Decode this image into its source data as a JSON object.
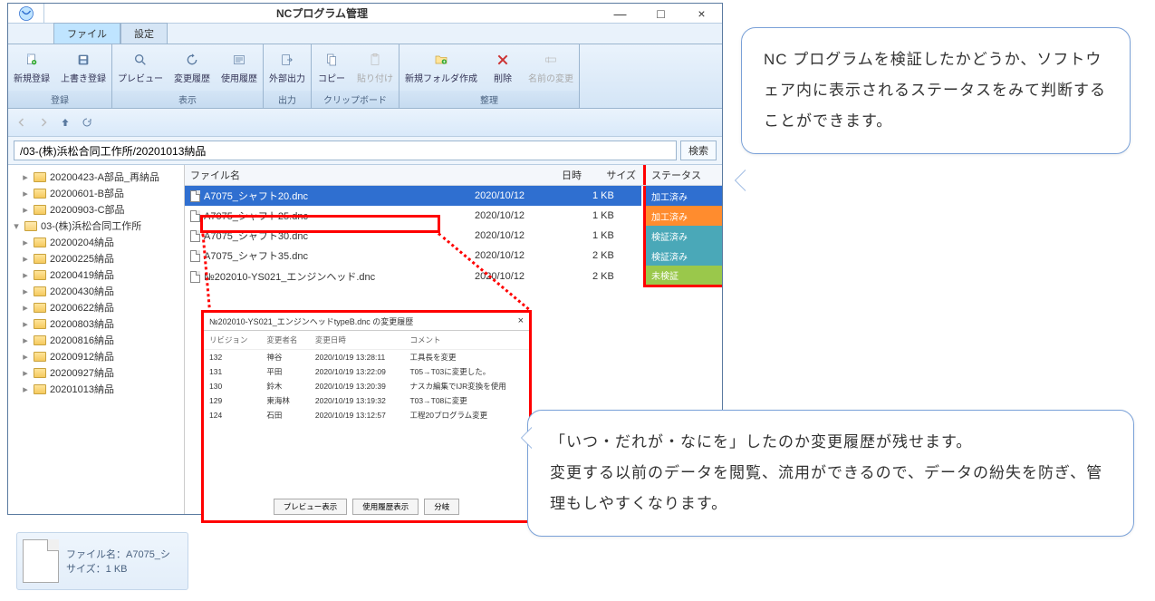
{
  "window": {
    "title": "NCプログラム管理"
  },
  "tabs": {
    "file": "ファイル",
    "settings": "設定"
  },
  "ribbon": {
    "groups": {
      "register": {
        "label": "登録",
        "btns": {
          "new": "新規登録",
          "overwrite": "上書き登録"
        }
      },
      "display": {
        "label": "表示",
        "btns": {
          "preview": "プレビュー",
          "changelog": "変更履歴",
          "usagelog": "使用履歴"
        }
      },
      "output": {
        "label": "出力",
        "btns": {
          "external": "外部出力"
        }
      },
      "clipboard": {
        "label": "クリップボード",
        "btns": {
          "copy": "コピー",
          "paste": "貼り付け"
        }
      },
      "organize": {
        "label": "整理",
        "btns": {
          "newfolder": "新規フォルダ作成",
          "delete": "削除",
          "rename": "名前の変更"
        }
      }
    }
  },
  "path": "/03-(株)浜松合同工作所/20201013納品",
  "search": {
    "label": "検索"
  },
  "tree": {
    "items": [
      {
        "name": "20200423-A部品_再納品",
        "depth": 1
      },
      {
        "name": "20200601-B部品",
        "depth": 1
      },
      {
        "name": "20200903-C部品",
        "depth": 1
      },
      {
        "name": "03-(株)浜松合同工作所",
        "depth": 0,
        "open": true
      },
      {
        "name": "20200204納品",
        "depth": 1
      },
      {
        "name": "20200225納品",
        "depth": 1
      },
      {
        "name": "20200419納品",
        "depth": 1
      },
      {
        "name": "20200430納品",
        "depth": 1
      },
      {
        "name": "20200622納品",
        "depth": 1
      },
      {
        "name": "20200803納品",
        "depth": 1
      },
      {
        "name": "20200816納品",
        "depth": 1
      },
      {
        "name": "20200912納品",
        "depth": 1
      },
      {
        "name": "20200927納品",
        "depth": 1
      },
      {
        "name": "20201013納品",
        "depth": 1
      }
    ]
  },
  "list": {
    "headers": {
      "name": "ファイル名",
      "date": "日時",
      "size": "サイズ",
      "status": "ステータス"
    },
    "rows": [
      {
        "name": "A7075_シャフト20.dnc",
        "date": "2020/10/12",
        "size": "1 KB",
        "status": "加工済み",
        "selected": true
      },
      {
        "name": "A7075_シャフト25.dnc",
        "date": "2020/10/12",
        "size": "1 KB",
        "status": "加工済み"
      },
      {
        "name": "A7075_シャフト30.dnc",
        "date": "2020/10/12",
        "size": "1 KB",
        "status": "検証済み"
      },
      {
        "name": "A7075_シャフト35.dnc",
        "date": "2020/10/12",
        "size": "2 KB",
        "status": "検証済み"
      },
      {
        "name": "№202010-YS021_エンジンヘッド.dnc",
        "date": "2020/10/12",
        "size": "2 KB",
        "status": "未検証"
      }
    ]
  },
  "detail": {
    "name_label": "ファイル名：A7075_シ",
    "size_label": "サイズ：1 KB"
  },
  "history": {
    "title": "№202010-YS021_エンジンヘッドtypeB.dnc の変更履歴",
    "headers": {
      "rev": "リビジョン",
      "user": "変更者名",
      "date": "変更日時",
      "comment": "コメント"
    },
    "rows": [
      {
        "rev": "132",
        "user": "神谷",
        "date": "2020/10/19 13:28:11",
        "comment": "工具長を変更"
      },
      {
        "rev": "131",
        "user": "平田",
        "date": "2020/10/19 13:22:09",
        "comment": "T05→T03に変更した。"
      },
      {
        "rev": "130",
        "user": "鈴木",
        "date": "2020/10/19 13:20:39",
        "comment": "ナスカ編集でIJR変換を使用"
      },
      {
        "rev": "129",
        "user": "東海林",
        "date": "2020/10/19 13:19:32",
        "comment": "T03→T08に変更"
      },
      {
        "rev": "124",
        "user": "石田",
        "date": "2020/10/19 13:12:57",
        "comment": "工程20プログラム変更"
      }
    ],
    "buttons": {
      "preview": "プレビュー表示",
      "usage": "使用履歴表示",
      "branch": "分岐"
    }
  },
  "bubbles": {
    "b1": "NC プログラムを検証したかどうか、ソフトウェア内に表示されるステータスをみて判断することができます。",
    "b2": "「いつ・だれが・なにを」したのか変更履歴が残せます。\n変更する以前のデータを閲覧、流用ができるので、データの紛失を防ぎ、管理もしやすくなります。"
  }
}
